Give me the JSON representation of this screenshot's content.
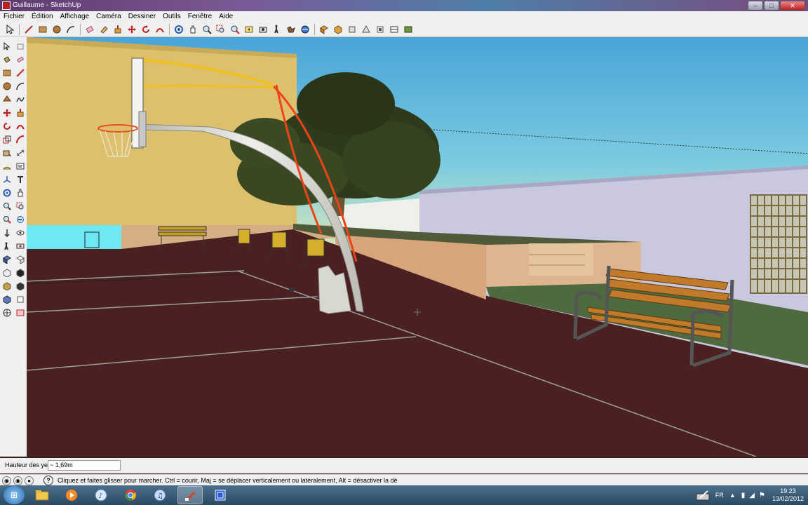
{
  "window": {
    "title": "Guillaume - SketchUp",
    "controls": {
      "minimize": "–",
      "maximize": "□",
      "close": "✕"
    }
  },
  "menu": [
    "Fichier",
    "Édition",
    "Affichage",
    "Caméra",
    "Dessiner",
    "Outils",
    "Fenêtre",
    "Aide"
  ],
  "toolbar_icons": [
    "select-icon",
    "line-icon",
    "rectangle-icon",
    "circle-icon",
    "arc-icon",
    "eraser-icon",
    "paint-icon",
    "push-pull-icon",
    "move-icon",
    "rotate-icon",
    "follow-me-icon",
    "orbit-icon",
    "pan-icon",
    "zoom-icon",
    "zoom-window-icon",
    "zoom-extents-icon",
    "previous-view-icon",
    "position-camera-icon",
    "walk-icon",
    "look-around-icon",
    "iso-view-icon",
    "top-view-icon",
    "front-view-icon",
    "right-view-icon",
    "back-view-icon",
    "left-view-icon"
  ],
  "left_tool_icons": [
    "select-icon",
    "make-component-icon",
    "paint-bucket-icon",
    "eraser-icon",
    "rectangle-icon",
    "line-icon",
    "circle-icon",
    "arc-icon",
    "polygon-icon",
    "freehand-icon",
    "move-icon",
    "push-pull-icon",
    "rotate-icon",
    "follow-me-icon",
    "scale-icon",
    "offset-icon",
    "tape-measure-icon",
    "dimension-icon",
    "protractor-icon",
    "text-icon",
    "axes-icon",
    "3d-text-icon",
    "orbit-icon",
    "pan-icon",
    "zoom-icon",
    "zoom-window-icon",
    "zoom-extents-icon",
    "previous-icon",
    "position-camera-icon",
    "look-around-icon",
    "walk-icon",
    "section-plane-icon",
    "iso-icon",
    "top-icon",
    "front-icon",
    "right-icon",
    "back-icon",
    "left-icon",
    "shadows-icon",
    "fog-icon",
    "add-location-icon",
    "toggle-terrain-icon"
  ],
  "vcb": {
    "label": "Hauteur des yeux",
    "value": "~ 1,69m"
  },
  "status": {
    "text": "Cliquez et faites glisser pour marcher.  Ctrl = courir, Maj = se déplacer verticalement ou latéralement, Alt = désactiver la dé"
  },
  "taskbar": {
    "apps": [
      "explorer-icon",
      "media-player-icon",
      "itunes-icon",
      "chrome-icon",
      "itunes-alt-icon",
      "sketchup-icon",
      "capture-icon"
    ],
    "language": "FR",
    "time": "19:23",
    "date": "13/02/2012"
  }
}
